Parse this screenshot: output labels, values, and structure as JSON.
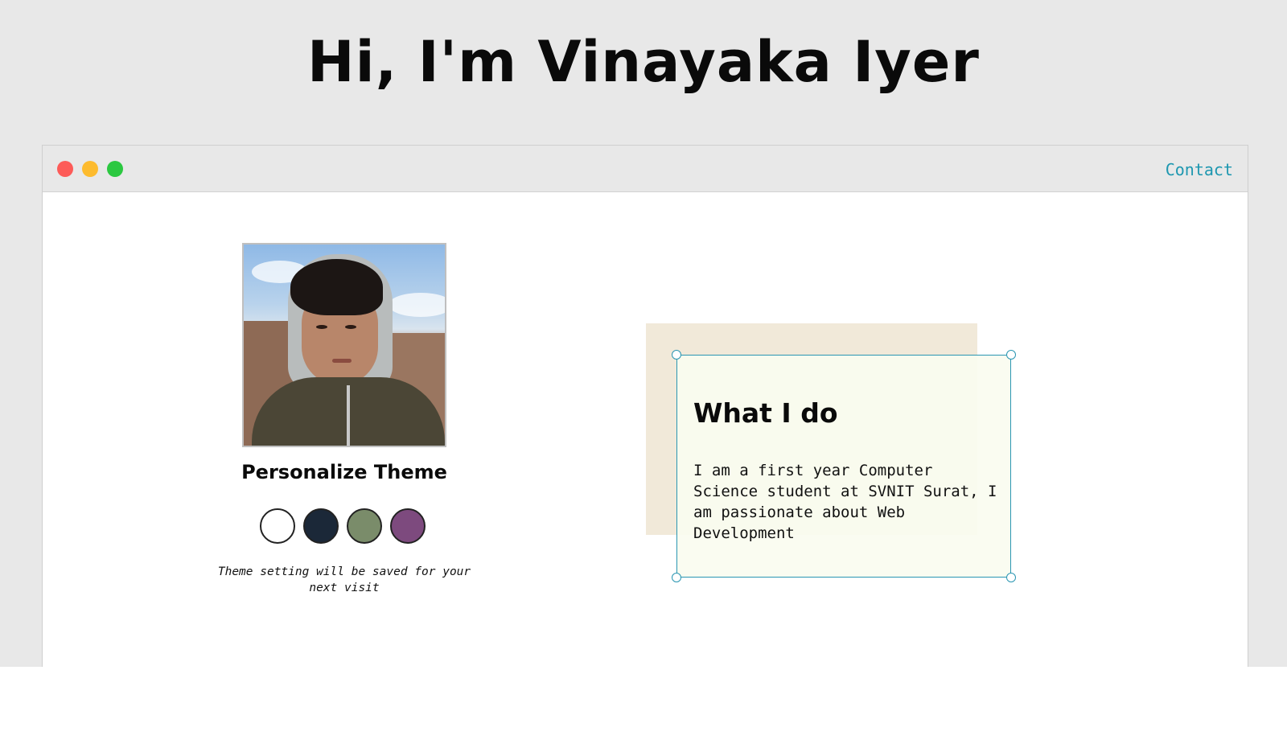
{
  "hero": {
    "title": "Hi, I'm Vinayaka Iyer"
  },
  "window": {
    "controls": [
      "close",
      "minimize",
      "maximize"
    ],
    "nav": {
      "contact_label": "Contact"
    }
  },
  "profile": {
    "photo_icon": "portrait-photo"
  },
  "theme": {
    "heading": "Personalize Theme",
    "swatches": [
      {
        "name": "light",
        "color": "#ffffff"
      },
      {
        "name": "dark-blue",
        "color": "#1b2838"
      },
      {
        "name": "green",
        "color": "#7a8c6a"
      },
      {
        "name": "purple",
        "color": "#7d4a7e"
      }
    ],
    "note": "Theme setting will be saved for your next visit"
  },
  "about": {
    "title": "What I do",
    "body": "I am a first year Computer Science student at SVNIT Surat, I am passionate about Web Development"
  },
  "colors": {
    "accent": "#1d97b0",
    "background": "#e8e8e8",
    "card": "#f9fbf0",
    "back_panel": "#f1e9d9"
  }
}
